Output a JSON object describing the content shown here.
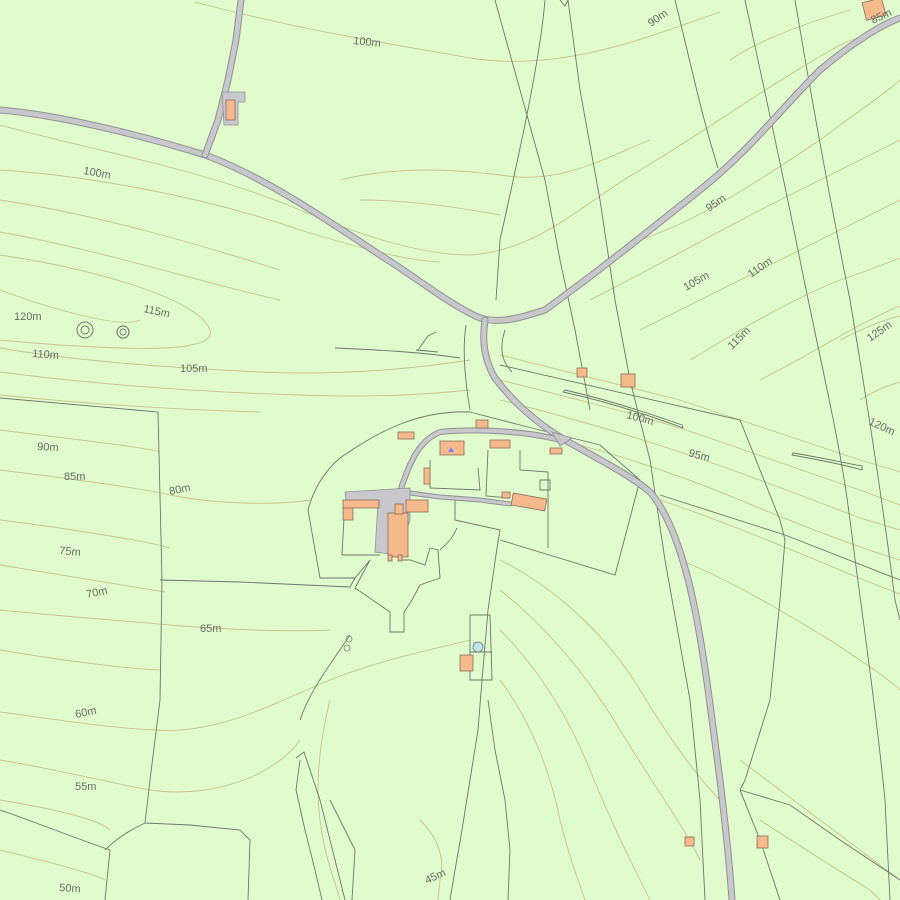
{
  "contour_labels": [
    {
      "id": "c-100-north",
      "text": "100m"
    },
    {
      "id": "c-90-northeast",
      "text": "90m"
    },
    {
      "id": "c-85-corner",
      "text": "85m"
    },
    {
      "id": "c-100-west",
      "text": "100m"
    },
    {
      "id": "c-95-east",
      "text": "95m"
    },
    {
      "id": "c-105-east",
      "text": "105m"
    },
    {
      "id": "c-110-east",
      "text": "110m"
    },
    {
      "id": "c-115-east",
      "text": "115m"
    },
    {
      "id": "c-125-east",
      "text": "125m"
    },
    {
      "id": "c-120-east",
      "text": "120m"
    },
    {
      "id": "c-120-west",
      "text": "120m"
    },
    {
      "id": "c-115-west",
      "text": "115m"
    },
    {
      "id": "c-110-west",
      "text": "110m"
    },
    {
      "id": "c-105-mid",
      "text": "105m"
    },
    {
      "id": "c-100-mid",
      "text": "100m"
    },
    {
      "id": "c-95-mid",
      "text": "95m"
    },
    {
      "id": "c-90-west",
      "text": "90m"
    },
    {
      "id": "c-85-west",
      "text": "85m"
    },
    {
      "id": "c-80-west",
      "text": "80m"
    },
    {
      "id": "c-75-west",
      "text": "75m"
    },
    {
      "id": "c-70-west",
      "text": "70m"
    },
    {
      "id": "c-65-mid",
      "text": "65m"
    },
    {
      "id": "c-60-west",
      "text": "60m"
    },
    {
      "id": "c-55-west",
      "text": "55m"
    },
    {
      "id": "c-50-west",
      "text": "50m"
    },
    {
      "id": "c-45-south",
      "text": "45m"
    }
  ],
  "colors": {
    "land": "#e0fccc",
    "contour": "#c9c08a",
    "boundary": "#6e756a",
    "road_fill": "#c8c8cc",
    "road_casing": "#8f8f94",
    "building": "#f6b98c",
    "pond": "#bfe6ee",
    "label": "#6a6a6a"
  },
  "symbols": [
    "tumulus-icon",
    "tumulus-icon",
    "pond-icon"
  ]
}
